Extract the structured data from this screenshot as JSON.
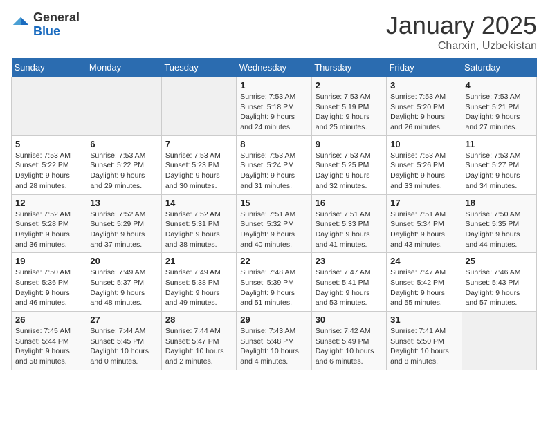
{
  "header": {
    "logo_line1": "General",
    "logo_line2": "Blue",
    "month_title": "January 2025",
    "location": "Charxin, Uzbekistan"
  },
  "weekdays": [
    "Sunday",
    "Monday",
    "Tuesday",
    "Wednesday",
    "Thursday",
    "Friday",
    "Saturday"
  ],
  "weeks": [
    [
      {
        "day": "",
        "info": ""
      },
      {
        "day": "",
        "info": ""
      },
      {
        "day": "",
        "info": ""
      },
      {
        "day": "1",
        "info": "Sunrise: 7:53 AM\nSunset: 5:18 PM\nDaylight: 9 hours\nand 24 minutes."
      },
      {
        "day": "2",
        "info": "Sunrise: 7:53 AM\nSunset: 5:19 PM\nDaylight: 9 hours\nand 25 minutes."
      },
      {
        "day": "3",
        "info": "Sunrise: 7:53 AM\nSunset: 5:20 PM\nDaylight: 9 hours\nand 26 minutes."
      },
      {
        "day": "4",
        "info": "Sunrise: 7:53 AM\nSunset: 5:21 PM\nDaylight: 9 hours\nand 27 minutes."
      }
    ],
    [
      {
        "day": "5",
        "info": "Sunrise: 7:53 AM\nSunset: 5:22 PM\nDaylight: 9 hours\nand 28 minutes."
      },
      {
        "day": "6",
        "info": "Sunrise: 7:53 AM\nSunset: 5:22 PM\nDaylight: 9 hours\nand 29 minutes."
      },
      {
        "day": "7",
        "info": "Sunrise: 7:53 AM\nSunset: 5:23 PM\nDaylight: 9 hours\nand 30 minutes."
      },
      {
        "day": "8",
        "info": "Sunrise: 7:53 AM\nSunset: 5:24 PM\nDaylight: 9 hours\nand 31 minutes."
      },
      {
        "day": "9",
        "info": "Sunrise: 7:53 AM\nSunset: 5:25 PM\nDaylight: 9 hours\nand 32 minutes."
      },
      {
        "day": "10",
        "info": "Sunrise: 7:53 AM\nSunset: 5:26 PM\nDaylight: 9 hours\nand 33 minutes."
      },
      {
        "day": "11",
        "info": "Sunrise: 7:53 AM\nSunset: 5:27 PM\nDaylight: 9 hours\nand 34 minutes."
      }
    ],
    [
      {
        "day": "12",
        "info": "Sunrise: 7:52 AM\nSunset: 5:28 PM\nDaylight: 9 hours\nand 36 minutes."
      },
      {
        "day": "13",
        "info": "Sunrise: 7:52 AM\nSunset: 5:29 PM\nDaylight: 9 hours\nand 37 minutes."
      },
      {
        "day": "14",
        "info": "Sunrise: 7:52 AM\nSunset: 5:31 PM\nDaylight: 9 hours\nand 38 minutes."
      },
      {
        "day": "15",
        "info": "Sunrise: 7:51 AM\nSunset: 5:32 PM\nDaylight: 9 hours\nand 40 minutes."
      },
      {
        "day": "16",
        "info": "Sunrise: 7:51 AM\nSunset: 5:33 PM\nDaylight: 9 hours\nand 41 minutes."
      },
      {
        "day": "17",
        "info": "Sunrise: 7:51 AM\nSunset: 5:34 PM\nDaylight: 9 hours\nand 43 minutes."
      },
      {
        "day": "18",
        "info": "Sunrise: 7:50 AM\nSunset: 5:35 PM\nDaylight: 9 hours\nand 44 minutes."
      }
    ],
    [
      {
        "day": "19",
        "info": "Sunrise: 7:50 AM\nSunset: 5:36 PM\nDaylight: 9 hours\nand 46 minutes."
      },
      {
        "day": "20",
        "info": "Sunrise: 7:49 AM\nSunset: 5:37 PM\nDaylight: 9 hours\nand 48 minutes."
      },
      {
        "day": "21",
        "info": "Sunrise: 7:49 AM\nSunset: 5:38 PM\nDaylight: 9 hours\nand 49 minutes."
      },
      {
        "day": "22",
        "info": "Sunrise: 7:48 AM\nSunset: 5:39 PM\nDaylight: 9 hours\nand 51 minutes."
      },
      {
        "day": "23",
        "info": "Sunrise: 7:47 AM\nSunset: 5:41 PM\nDaylight: 9 hours\nand 53 minutes."
      },
      {
        "day": "24",
        "info": "Sunrise: 7:47 AM\nSunset: 5:42 PM\nDaylight: 9 hours\nand 55 minutes."
      },
      {
        "day": "25",
        "info": "Sunrise: 7:46 AM\nSunset: 5:43 PM\nDaylight: 9 hours\nand 57 minutes."
      }
    ],
    [
      {
        "day": "26",
        "info": "Sunrise: 7:45 AM\nSunset: 5:44 PM\nDaylight: 9 hours\nand 58 minutes."
      },
      {
        "day": "27",
        "info": "Sunrise: 7:44 AM\nSunset: 5:45 PM\nDaylight: 10 hours\nand 0 minutes."
      },
      {
        "day": "28",
        "info": "Sunrise: 7:44 AM\nSunset: 5:47 PM\nDaylight: 10 hours\nand 2 minutes."
      },
      {
        "day": "29",
        "info": "Sunrise: 7:43 AM\nSunset: 5:48 PM\nDaylight: 10 hours\nand 4 minutes."
      },
      {
        "day": "30",
        "info": "Sunrise: 7:42 AM\nSunset: 5:49 PM\nDaylight: 10 hours\nand 6 minutes."
      },
      {
        "day": "31",
        "info": "Sunrise: 7:41 AM\nSunset: 5:50 PM\nDaylight: 10 hours\nand 8 minutes."
      },
      {
        "day": "",
        "info": ""
      }
    ]
  ]
}
